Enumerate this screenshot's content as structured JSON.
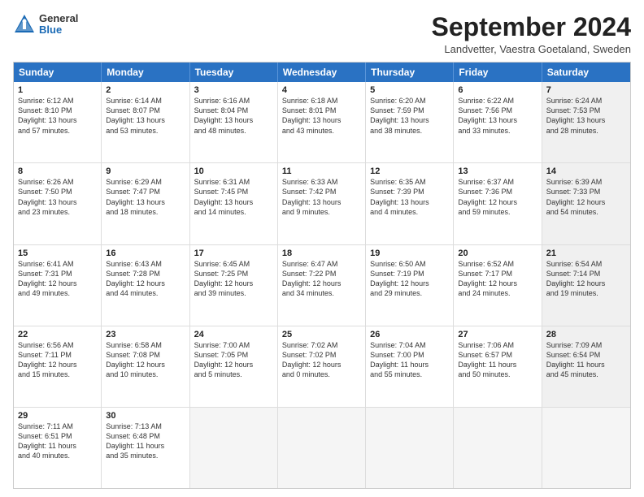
{
  "logo": {
    "general": "General",
    "blue": "Blue"
  },
  "title": {
    "month": "September 2024",
    "location": "Landvetter, Vaestra Goetaland, Sweden"
  },
  "header_days": [
    "Sunday",
    "Monday",
    "Tuesday",
    "Wednesday",
    "Thursday",
    "Friday",
    "Saturday"
  ],
  "weeks": [
    [
      {
        "day": "1",
        "lines": [
          "Sunrise: 6:12 AM",
          "Sunset: 8:10 PM",
          "Daylight: 13 hours",
          "and 57 minutes."
        ],
        "shaded": false
      },
      {
        "day": "2",
        "lines": [
          "Sunrise: 6:14 AM",
          "Sunset: 8:07 PM",
          "Daylight: 13 hours",
          "and 53 minutes."
        ],
        "shaded": false
      },
      {
        "day": "3",
        "lines": [
          "Sunrise: 6:16 AM",
          "Sunset: 8:04 PM",
          "Daylight: 13 hours",
          "and 48 minutes."
        ],
        "shaded": false
      },
      {
        "day": "4",
        "lines": [
          "Sunrise: 6:18 AM",
          "Sunset: 8:01 PM",
          "Daylight: 13 hours",
          "and 43 minutes."
        ],
        "shaded": false
      },
      {
        "day": "5",
        "lines": [
          "Sunrise: 6:20 AM",
          "Sunset: 7:59 PM",
          "Daylight: 13 hours",
          "and 38 minutes."
        ],
        "shaded": false
      },
      {
        "day": "6",
        "lines": [
          "Sunrise: 6:22 AM",
          "Sunset: 7:56 PM",
          "Daylight: 13 hours",
          "and 33 minutes."
        ],
        "shaded": false
      },
      {
        "day": "7",
        "lines": [
          "Sunrise: 6:24 AM",
          "Sunset: 7:53 PM",
          "Daylight: 13 hours",
          "and 28 minutes."
        ],
        "shaded": true
      }
    ],
    [
      {
        "day": "8",
        "lines": [
          "Sunrise: 6:26 AM",
          "Sunset: 7:50 PM",
          "Daylight: 13 hours",
          "and 23 minutes."
        ],
        "shaded": false
      },
      {
        "day": "9",
        "lines": [
          "Sunrise: 6:29 AM",
          "Sunset: 7:47 PM",
          "Daylight: 13 hours",
          "and 18 minutes."
        ],
        "shaded": false
      },
      {
        "day": "10",
        "lines": [
          "Sunrise: 6:31 AM",
          "Sunset: 7:45 PM",
          "Daylight: 13 hours",
          "and 14 minutes."
        ],
        "shaded": false
      },
      {
        "day": "11",
        "lines": [
          "Sunrise: 6:33 AM",
          "Sunset: 7:42 PM",
          "Daylight: 13 hours",
          "and 9 minutes."
        ],
        "shaded": false
      },
      {
        "day": "12",
        "lines": [
          "Sunrise: 6:35 AM",
          "Sunset: 7:39 PM",
          "Daylight: 13 hours",
          "and 4 minutes."
        ],
        "shaded": false
      },
      {
        "day": "13",
        "lines": [
          "Sunrise: 6:37 AM",
          "Sunset: 7:36 PM",
          "Daylight: 12 hours",
          "and 59 minutes."
        ],
        "shaded": false
      },
      {
        "day": "14",
        "lines": [
          "Sunrise: 6:39 AM",
          "Sunset: 7:33 PM",
          "Daylight: 12 hours",
          "and 54 minutes."
        ],
        "shaded": true
      }
    ],
    [
      {
        "day": "15",
        "lines": [
          "Sunrise: 6:41 AM",
          "Sunset: 7:31 PM",
          "Daylight: 12 hours",
          "and 49 minutes."
        ],
        "shaded": false
      },
      {
        "day": "16",
        "lines": [
          "Sunrise: 6:43 AM",
          "Sunset: 7:28 PM",
          "Daylight: 12 hours",
          "and 44 minutes."
        ],
        "shaded": false
      },
      {
        "day": "17",
        "lines": [
          "Sunrise: 6:45 AM",
          "Sunset: 7:25 PM",
          "Daylight: 12 hours",
          "and 39 minutes."
        ],
        "shaded": false
      },
      {
        "day": "18",
        "lines": [
          "Sunrise: 6:47 AM",
          "Sunset: 7:22 PM",
          "Daylight: 12 hours",
          "and 34 minutes."
        ],
        "shaded": false
      },
      {
        "day": "19",
        "lines": [
          "Sunrise: 6:50 AM",
          "Sunset: 7:19 PM",
          "Daylight: 12 hours",
          "and 29 minutes."
        ],
        "shaded": false
      },
      {
        "day": "20",
        "lines": [
          "Sunrise: 6:52 AM",
          "Sunset: 7:17 PM",
          "Daylight: 12 hours",
          "and 24 minutes."
        ],
        "shaded": false
      },
      {
        "day": "21",
        "lines": [
          "Sunrise: 6:54 AM",
          "Sunset: 7:14 PM",
          "Daylight: 12 hours",
          "and 19 minutes."
        ],
        "shaded": true
      }
    ],
    [
      {
        "day": "22",
        "lines": [
          "Sunrise: 6:56 AM",
          "Sunset: 7:11 PM",
          "Daylight: 12 hours",
          "and 15 minutes."
        ],
        "shaded": false
      },
      {
        "day": "23",
        "lines": [
          "Sunrise: 6:58 AM",
          "Sunset: 7:08 PM",
          "Daylight: 12 hours",
          "and 10 minutes."
        ],
        "shaded": false
      },
      {
        "day": "24",
        "lines": [
          "Sunrise: 7:00 AM",
          "Sunset: 7:05 PM",
          "Daylight: 12 hours",
          "and 5 minutes."
        ],
        "shaded": false
      },
      {
        "day": "25",
        "lines": [
          "Sunrise: 7:02 AM",
          "Sunset: 7:02 PM",
          "Daylight: 12 hours",
          "and 0 minutes."
        ],
        "shaded": false
      },
      {
        "day": "26",
        "lines": [
          "Sunrise: 7:04 AM",
          "Sunset: 7:00 PM",
          "Daylight: 11 hours",
          "and 55 minutes."
        ],
        "shaded": false
      },
      {
        "day": "27",
        "lines": [
          "Sunrise: 7:06 AM",
          "Sunset: 6:57 PM",
          "Daylight: 11 hours",
          "and 50 minutes."
        ],
        "shaded": false
      },
      {
        "day": "28",
        "lines": [
          "Sunrise: 7:09 AM",
          "Sunset: 6:54 PM",
          "Daylight: 11 hours",
          "and 45 minutes."
        ],
        "shaded": true
      }
    ],
    [
      {
        "day": "29",
        "lines": [
          "Sunrise: 7:11 AM",
          "Sunset: 6:51 PM",
          "Daylight: 11 hours",
          "and 40 minutes."
        ],
        "shaded": false
      },
      {
        "day": "30",
        "lines": [
          "Sunrise: 7:13 AM",
          "Sunset: 6:48 PM",
          "Daylight: 11 hours",
          "and 35 minutes."
        ],
        "shaded": false
      },
      {
        "day": "",
        "lines": [],
        "shaded": true,
        "empty": true
      },
      {
        "day": "",
        "lines": [],
        "shaded": true,
        "empty": true
      },
      {
        "day": "",
        "lines": [],
        "shaded": true,
        "empty": true
      },
      {
        "day": "",
        "lines": [],
        "shaded": true,
        "empty": true
      },
      {
        "day": "",
        "lines": [],
        "shaded": true,
        "empty": true
      }
    ]
  ]
}
